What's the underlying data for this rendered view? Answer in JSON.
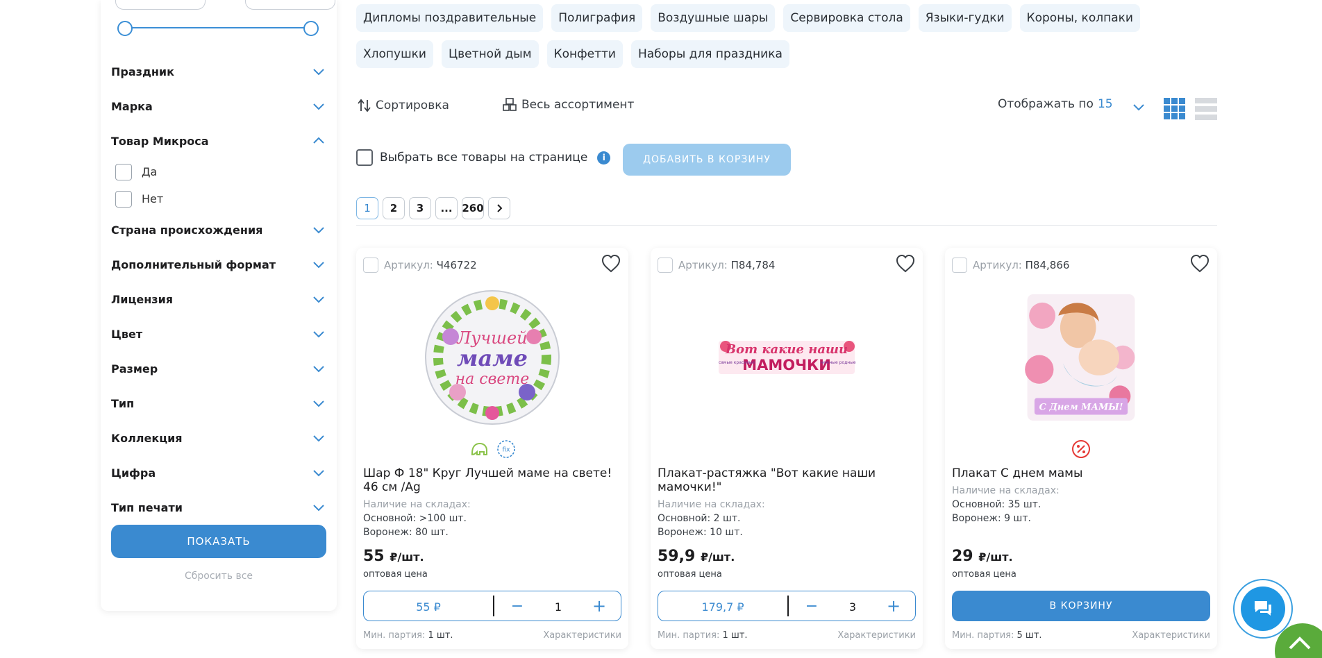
{
  "sidebar": {
    "filters_top": [
      {
        "label": "Праздник"
      },
      {
        "label": "Марка"
      }
    ],
    "open_filter": {
      "label": "Товар Микроса",
      "options": [
        "Да",
        "Нет"
      ]
    },
    "filters_bottom": [
      {
        "label": "Страна происхождения"
      },
      {
        "label": "Дополнительный формат"
      },
      {
        "label": "Лицензия"
      },
      {
        "label": "Цвет"
      },
      {
        "label": "Размер"
      },
      {
        "label": "Тип"
      },
      {
        "label": "Коллекция"
      },
      {
        "label": "Цифра"
      },
      {
        "label": "Тип печати"
      }
    ],
    "show_button": "ПОКАЗАТЬ",
    "reset_link": "Сбросить все"
  },
  "tags": [
    "Дипломы поздравительные",
    "Полиграфия",
    "Воздушные шары",
    "Сервировка стола",
    "Языки-гудки",
    "Короны, колпаки",
    "Хлопушки",
    "Цветной дым",
    "Конфетти",
    "Наборы для праздника"
  ],
  "toolbar": {
    "sort_label": "Сортировка",
    "assortment_label": "Весь ассортимент",
    "per_page_label": "Отображать по",
    "per_page_value": "15",
    "select_all_label": "Выбрать все товары на странице",
    "info_icon": "i",
    "add_to_cart_label": "ДОБАВИТЬ В КОРЗИНУ"
  },
  "pagination": {
    "pages": [
      "1",
      "2",
      "3",
      "...",
      "260"
    ],
    "active": "1",
    "next_icon": "chevron-right-icon"
  },
  "products": [
    {
      "sku_label": "Артикул:",
      "sku": "Ч46722",
      "name": "Шар Ф 18\" Круг Лучшей маме на свете! 46 см /Ag",
      "stock_title": "Наличие на складах:",
      "stock": [
        "Основной: >100 шт.",
        "Воронеж: 80 шт."
      ],
      "price": "55",
      "price_unit": "₽/шт.",
      "price_note": "оптовая цена",
      "total": "55 ₽",
      "qty": "1",
      "minlot_label": "Мин. партия:",
      "minlot": "1 шт.",
      "chars": "Характеристики",
      "image_text": [
        "Лучшей",
        "маме",
        "на свете"
      ]
    },
    {
      "sku_label": "Артикул:",
      "sku": "П84,784",
      "name": "Плакат-растяжка \"Вот какие наши мамочки!\"",
      "stock_title": "Наличие на складах:",
      "stock": [
        "Основной: 2 шт.",
        "Воронеж: 10 шт."
      ],
      "price": "59,9",
      "price_unit": "₽/шт.",
      "price_note": "оптовая цена",
      "total": "179,7 ₽",
      "qty": "3",
      "minlot_label": "Мин. партия:",
      "minlot": "1 шт.",
      "chars": "Характеристики",
      "image_text": [
        "Вот какие наши",
        "МАМОЧКИ",
        "самые красивые",
        "нежные родные"
      ]
    },
    {
      "sku_label": "Артикул:",
      "sku": "П84,866",
      "name": "Плакат С днем мамы",
      "stock_title": "Наличие на складах:",
      "stock": [
        "Основной: 35 шт.",
        "Воронеж: 9 шт."
      ],
      "price": "29",
      "price_unit": "₽/шт.",
      "price_note": "оптовая цена",
      "cart_button": "В КОРЗИНУ",
      "minlot_label": "Мин. партия:",
      "minlot": "5 шт.",
      "chars": "Характеристики",
      "image_text": [
        "С Днем МАМЫ!"
      ]
    }
  ],
  "colors": {
    "accent": "#3a8ad0",
    "tag_bg": "#eef5fb",
    "chat": "#1f97e3",
    "scroll_up": "#5aab3b"
  }
}
